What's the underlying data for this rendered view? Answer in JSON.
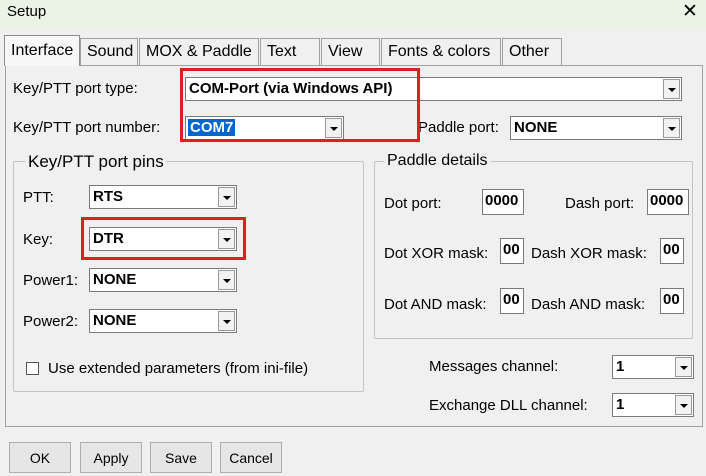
{
  "window": {
    "title": "Setup",
    "close_glyph": "✕"
  },
  "tabs": [
    {
      "label": "Interface",
      "active": true
    },
    {
      "label": "Sound"
    },
    {
      "label": "MOX & Paddle"
    },
    {
      "label": "Text"
    },
    {
      "label": "View"
    },
    {
      "label": "Fonts & colors"
    },
    {
      "label": "Other"
    }
  ],
  "interface": {
    "port_type": {
      "label": "Key/PTT port type:",
      "value": "COM-Port (via Windows API)"
    },
    "port_number": {
      "label": "Key/PTT port number:",
      "value": "COM7"
    },
    "paddle_port": {
      "label": "Paddle port:",
      "value": "NONE"
    },
    "pins": {
      "title": "Key/PTT port pins",
      "ptt": {
        "label": "PTT:",
        "value": "RTS"
      },
      "key": {
        "label": "Key:",
        "value": "DTR"
      },
      "power1": {
        "label": "Power1:",
        "value": "NONE"
      },
      "power2": {
        "label": "Power2:",
        "value": "NONE"
      },
      "extended": {
        "label": "Use extended parameters (from ini-file)",
        "checked": false
      }
    },
    "paddle_details": {
      "title": "Paddle details",
      "dot_port": {
        "label": "Dot port:",
        "value": "0000"
      },
      "dash_port": {
        "label": "Dash port:",
        "value": "0000"
      },
      "dot_xor": {
        "label": "Dot XOR mask:",
        "value": "00"
      },
      "dash_xor": {
        "label": "Dash XOR mask:",
        "value": "00"
      },
      "dot_and": {
        "label": "Dot AND mask:",
        "value": "00"
      },
      "dash_and": {
        "label": "Dash AND mask:",
        "value": "00"
      }
    },
    "messages_channel": {
      "label": "Messages channel:",
      "value": "1"
    },
    "exchange_channel": {
      "label": "Exchange DLL channel:",
      "value": "1"
    }
  },
  "buttons": {
    "ok": "OK",
    "apply": "Apply",
    "save": "Save",
    "cancel": "Cancel"
  },
  "colors": {
    "highlight": "#e02020",
    "selection": "#0066cc"
  }
}
